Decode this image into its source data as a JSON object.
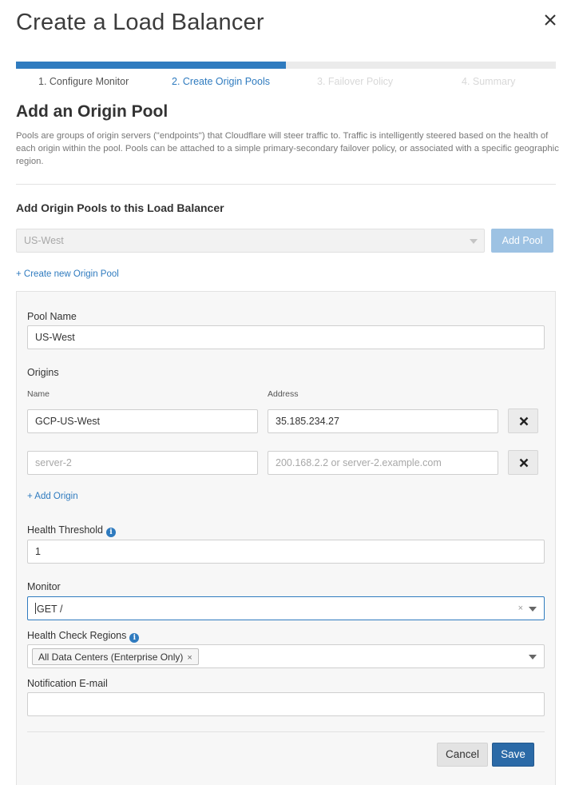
{
  "dialog": {
    "title": "Create a Load Balancer",
    "close_icon": "close-icon"
  },
  "wizard": {
    "progress_fraction": 0.5,
    "steps": [
      {
        "label": "1. Configure Monitor",
        "state": "done"
      },
      {
        "label": "2. Create Origin Pools",
        "state": "active"
      },
      {
        "label": "3. Failover Policy",
        "state": "pending"
      },
      {
        "label": "4. Summary",
        "state": "pending"
      }
    ]
  },
  "section": {
    "title": "Add an Origin Pool",
    "description": "Pools are groups of origin servers (\"endpoints\") that Cloudflare will steer traffic to. Traffic is intelligently steered based on the health of each origin within the pool. Pools can be attached to a simple primary-secondary failover policy, or associated with a specific geographic region."
  },
  "pools": {
    "heading": "Add Origin Pools to this Load Balancer",
    "selected_pool": "US-West",
    "add_pool_label": "Add Pool",
    "create_link": "+ Create new Origin Pool"
  },
  "pool_form": {
    "pool_name_label": "Pool Name",
    "pool_name_value": "US-West",
    "origins_label": "Origins",
    "name_col_label": "Name",
    "address_col_label": "Address",
    "origins": [
      {
        "name": "GCP-US-West",
        "address": "35.185.234.27"
      },
      {
        "name_placeholder": "server-2",
        "address_placeholder": "200.168.2.2 or server-2.example.com"
      }
    ],
    "add_origin_link": "+ Add Origin",
    "health_threshold_label": "Health Threshold",
    "health_threshold_value": "1",
    "monitor_label": "Monitor",
    "monitor_value": "GET /",
    "health_regions_label": "Health Check Regions",
    "health_regions_tag": "All Data Centers (Enterprise Only)",
    "notification_label": "Notification E-mail",
    "notification_value": "",
    "info_icon_glyph": "i"
  },
  "footer": {
    "cancel_label": "Cancel",
    "save_label": "Save"
  },
  "colors": {
    "accent": "#2f7bbf",
    "save_button": "#2b6aa7",
    "add_pool_disabled": "#9dc2e3"
  }
}
